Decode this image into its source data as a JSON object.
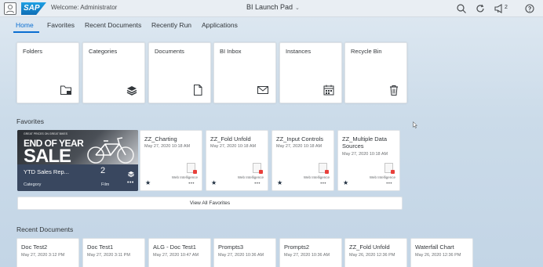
{
  "header": {
    "welcome": "Welcome: Administrator",
    "title": "BI Launch Pad",
    "logo_text": "SAP",
    "notification_count": "2"
  },
  "tabs": [
    {
      "label": "Home",
      "active": true
    },
    {
      "label": "Favorites"
    },
    {
      "label": "Recent Documents"
    },
    {
      "label": "Recently Run"
    },
    {
      "label": "Applications"
    }
  ],
  "tiles": [
    {
      "label": "Folders",
      "icon": "folder-icon"
    },
    {
      "label": "Categories",
      "icon": "categories-icon"
    },
    {
      "label": "Documents",
      "icon": "document-icon"
    },
    {
      "label": "BI Inbox",
      "icon": "inbox-icon"
    },
    {
      "label": "Instances",
      "icon": "calendar-icon"
    },
    {
      "label": "Recycle Bin",
      "icon": "trash-icon"
    }
  ],
  "favorites": {
    "title": "Favorites",
    "promo": {
      "headline_small": "GREAT PRICES ON GREAT BIKES",
      "headline_1": "END OF YEAR",
      "headline_2": "SALE",
      "name": "YTD Sales Rep...",
      "category": "Category",
      "count": "2",
      "count_label": "Film",
      "more": "•••"
    },
    "items": [
      {
        "title": "ZZ_Charting",
        "date": "May 27, 2020 10:18 AM",
        "type": "Web Intelligence",
        "more": "•••"
      },
      {
        "title": "ZZ_Fold Unfold",
        "date": "May 27, 2020 10:18 AM",
        "type": "Web Intelligence",
        "more": "•••"
      },
      {
        "title": "ZZ_Input Controls",
        "date": "May 27, 2020 10:18 AM",
        "type": "Web Intelligence",
        "more": "•••"
      },
      {
        "title": "ZZ_Multiple Data Sources",
        "date": "May 27, 2020 10:18 AM",
        "type": "Web Intelligence",
        "more": "•••"
      }
    ],
    "view_all": "View All Favorites"
  },
  "recent": {
    "title": "Recent Documents",
    "items": [
      {
        "title": "Doc Test2",
        "date": "May 27, 2020 3:12 PM"
      },
      {
        "title": "Doc Test1",
        "date": "May 27, 2020 3:11 PM"
      },
      {
        "title": "ALG - Doc Test1",
        "date": "May 27, 2020 10:47 AM"
      },
      {
        "title": "Prompts3",
        "date": "May 27, 2020 10:36 AM"
      },
      {
        "title": "Prompts2",
        "date": "May 27, 2020 10:36 AM"
      },
      {
        "title": "ZZ_Fold Unfold",
        "date": "May 26, 2020 12:36 PM"
      },
      {
        "title": "Waterfall Chart",
        "date": "May 26, 2020 12:36 PM"
      }
    ]
  },
  "colors": {
    "accent": "#0a6ed1",
    "promo_overlay": "#3a4860"
  }
}
